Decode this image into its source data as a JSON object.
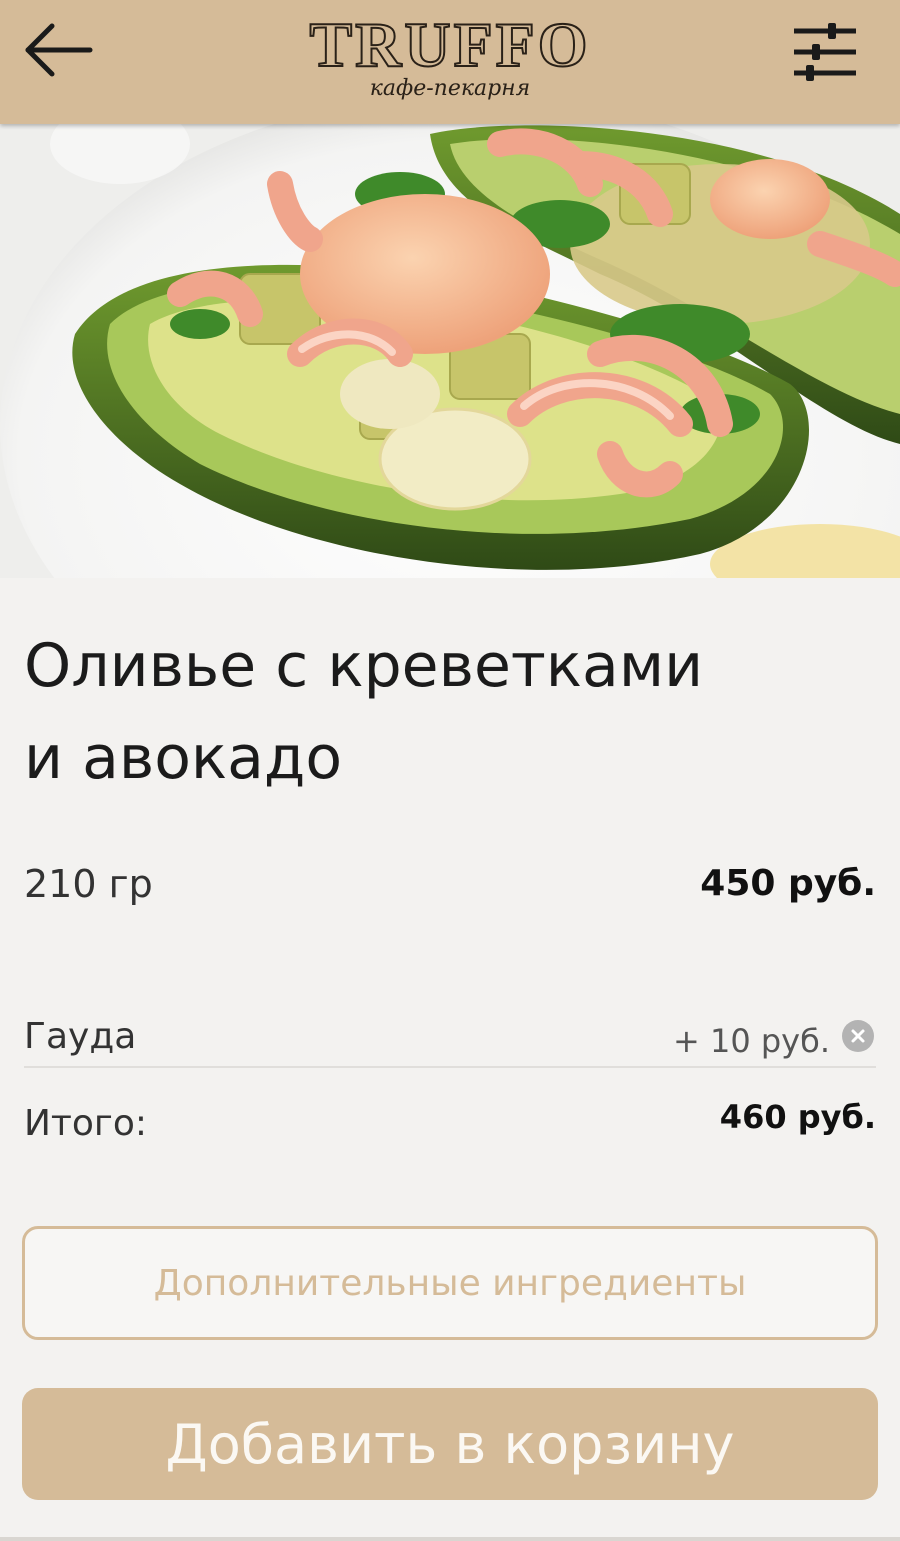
{
  "header": {
    "logo_title": "TRUFFO",
    "logo_subtitle": "кафе-пекарня",
    "back_icon": "arrow-left-icon",
    "filter_icon": "sliders-icon",
    "background_color": "#d5bb98"
  },
  "hero": {
    "image_subject": "avocado-shrimp-salad-photo"
  },
  "dish": {
    "title_line1": "Оливье с креветками",
    "title_line2": "и авокадо",
    "weight": "210 гр",
    "price": "450 руб."
  },
  "addons": [
    {
      "name": "Гауда",
      "price": "+ 10 руб.",
      "remove_icon": "close-circle-icon"
    }
  ],
  "total": {
    "label": "Итого:",
    "value": "460 руб."
  },
  "buttons": {
    "extra_ingredients": "Дополнительные ингредиенты",
    "add_to_cart": "Добавить в корзину"
  },
  "colors": {
    "accent": "#d5bb98",
    "background": "#f3f2f0"
  }
}
